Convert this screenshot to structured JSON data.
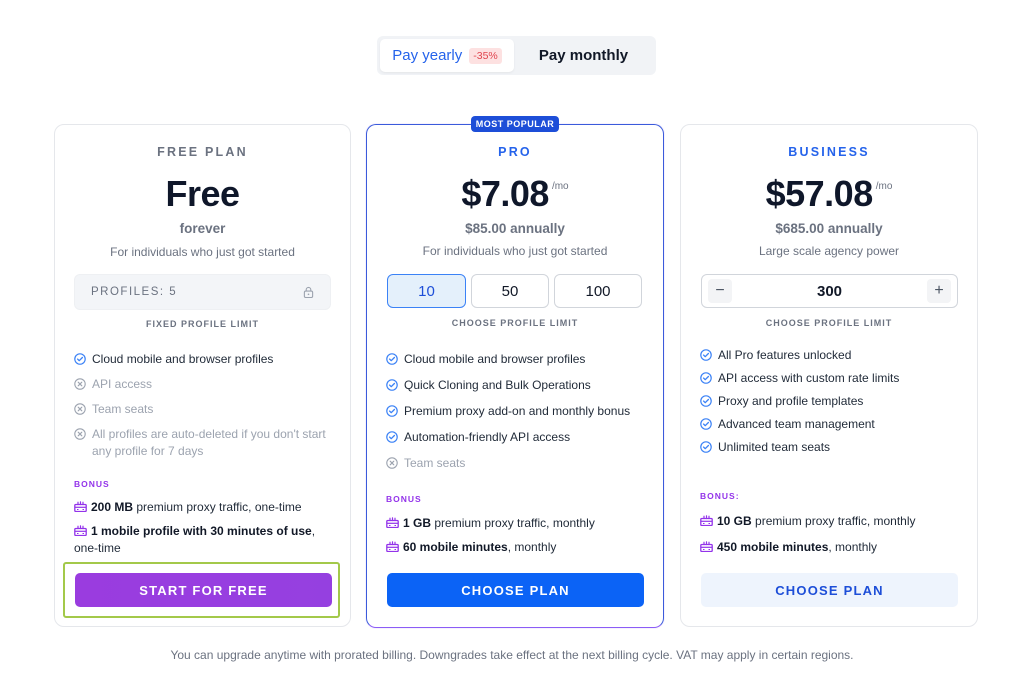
{
  "billing_toggle": {
    "yearly_label": "Pay yearly",
    "yearly_discount": "-35%",
    "monthly_label": "Pay monthly"
  },
  "popular_badge": "MOST POPULAR",
  "plans": {
    "free": {
      "name": "FREE PLAN",
      "price": "Free",
      "sub1": "forever",
      "sub2": "For individuals who just got started",
      "profiles_box": "PROFILES: 5",
      "limit_label": "FIXED PROFILE LIMIT",
      "features": [
        {
          "text": "Cloud mobile and browser profiles",
          "included": true
        },
        {
          "text": "API access",
          "included": false
        },
        {
          "text": "Team seats",
          "included": false
        },
        {
          "text": "All profiles are auto-deleted if you don't start any profile for 7 days",
          "included": false
        }
      ],
      "bonus_label": "BONUS",
      "bonus": [
        {
          "bold": "200 MB",
          "rest": " premium proxy traffic, one-time"
        },
        {
          "bold": "1 mobile profile with 30 minutes of use",
          "rest": ", one-time"
        }
      ],
      "cta": "START FOR FREE"
    },
    "pro": {
      "name": "PRO",
      "price": "$7.08",
      "per": "/mo",
      "sub1": "$85.00 annually",
      "sub2": "For individuals who just got started",
      "options": [
        "10",
        "50",
        "100"
      ],
      "selected": "10",
      "limit_label": "CHOOSE PROFILE LIMIT",
      "features": [
        {
          "text": "Cloud mobile and browser profiles",
          "included": true
        },
        {
          "text": "Quick Cloning and Bulk Operations",
          "included": true
        },
        {
          "text": "Premium proxy add-on and monthly bonus",
          "included": true
        },
        {
          "text": "Automation-friendly API access",
          "included": true
        },
        {
          "text": "Team seats",
          "included": false
        }
      ],
      "bonus_label": "BONUS",
      "bonus": [
        {
          "bold": "1 GB",
          "rest": " premium proxy traffic, monthly"
        },
        {
          "bold": "60 mobile minutes",
          "rest": ", monthly"
        }
      ],
      "cta": "CHOOSE PLAN"
    },
    "business": {
      "name": "BUSINESS",
      "price": "$57.08",
      "per": "/mo",
      "sub1": "$685.00 annually",
      "sub2": "Large scale agency power",
      "stepper_value": "300",
      "stepper_minus": "−",
      "stepper_plus": "+",
      "limit_label": "CHOOSE PROFILE LIMIT",
      "features": [
        {
          "text": "All Pro features unlocked",
          "included": true
        },
        {
          "text": "API access with custom rate limits",
          "included": true
        },
        {
          "text": "Proxy and profile templates",
          "included": true
        },
        {
          "text": "Advanced team management",
          "included": true
        },
        {
          "text": "Unlimited team seats",
          "included": true
        }
      ],
      "bonus_label": "BONUS:",
      "bonus": [
        {
          "bold": "10 GB",
          "rest": " premium proxy traffic, monthly"
        },
        {
          "bold": "450 mobile minutes",
          "rest": ", monthly"
        }
      ],
      "cta": "CHOOSE PLAN"
    }
  },
  "footer_note": "You can upgrade anytime with prorated billing. Downgrades take effect at the next billing cycle. VAT may apply in certain regions.",
  "colors": {
    "accent_blue": "#2563eb",
    "accent_purple": "#9333ea",
    "check": "#3b82f6",
    "cross": "#9ca3af"
  }
}
